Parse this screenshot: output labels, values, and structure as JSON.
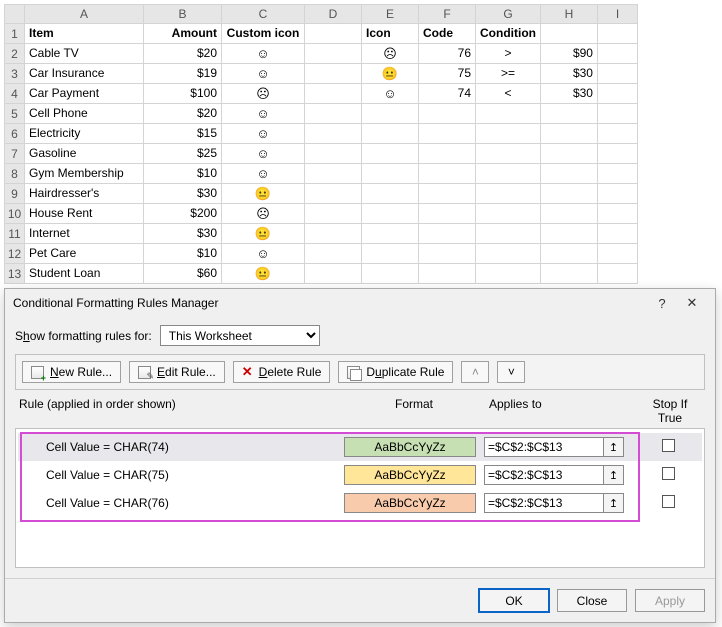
{
  "grid": {
    "columns": [
      "A",
      "B",
      "C",
      "D",
      "E",
      "F",
      "G",
      "H",
      "I"
    ],
    "headers": {
      "item": "Item",
      "amount": "Amount",
      "custom": "Custom icon",
      "icon": "Icon",
      "code": "Code",
      "condition": "Condition"
    },
    "rows": [
      {
        "n": 1
      },
      {
        "n": 2,
        "item": "Cable TV",
        "amount": "$20",
        "face": "☺",
        "faceCls": "bg-green",
        "icon": "☹",
        "code": "76",
        "cond": ">",
        "val": "$90"
      },
      {
        "n": 3,
        "item": "Car Insurance",
        "amount": "$19",
        "face": "☺",
        "faceCls": "bg-green",
        "icon": "😐",
        "code": "75",
        "cond": ">=",
        "val": "$30"
      },
      {
        "n": 4,
        "item": "Car Payment",
        "amount": "$100",
        "face": "☹",
        "faceCls": "bg-orange",
        "icon": "☺",
        "code": "74",
        "cond": "<",
        "val": "$30"
      },
      {
        "n": 5,
        "item": "Cell Phone",
        "amount": "$20",
        "face": "☺",
        "faceCls": "bg-green"
      },
      {
        "n": 6,
        "item": "Electricity",
        "amount": "$15",
        "face": "☺",
        "faceCls": "bg-green"
      },
      {
        "n": 7,
        "item": "Gasoline",
        "amount": "$25",
        "face": "☺",
        "faceCls": "bg-green"
      },
      {
        "n": 8,
        "item": "Gym Membership",
        "amount": "$10",
        "face": "☺",
        "faceCls": "bg-green"
      },
      {
        "n": 9,
        "item": "Hairdresser's",
        "amount": "$30",
        "face": "😐",
        "faceCls": "bg-yellow"
      },
      {
        "n": 10,
        "item": "House Rent",
        "amount": "$200",
        "face": "☹",
        "faceCls": "bg-orange"
      },
      {
        "n": 11,
        "item": "Internet",
        "amount": "$30",
        "face": "😐",
        "faceCls": "bg-yellow"
      },
      {
        "n": 12,
        "item": "Pet Care",
        "amount": "$10",
        "face": "☺",
        "faceCls": "bg-green"
      },
      {
        "n": 13,
        "item": "Student Loan",
        "amount": "$60",
        "face": "😐",
        "faceCls": "bg-yellow"
      }
    ]
  },
  "dialog": {
    "title": "Conditional Formatting Rules Manager",
    "help": "?",
    "close": "✕",
    "show_label_pre": "S",
    "show_label_u": "h",
    "show_label_post": "ow formatting rules for:",
    "show_value": "This Worksheet",
    "toolbar": {
      "new_u": "N",
      "new": "ew Rule...",
      "edit_u": "E",
      "edit": "dit Rule...",
      "delete_u": "D",
      "delete": "elete Rule",
      "dup": "D",
      "dup_u": "u",
      "dup_post": "plicate Rule"
    },
    "headers": {
      "rule": "Rule (applied in order shown)",
      "format": "Format",
      "applies": "Applies to",
      "stop": "Stop If True"
    },
    "rules": [
      {
        "rule": "Cell Value = CHAR(74)",
        "fmt": "AaBbCcYyZz",
        "fmtCls": "bg-green",
        "applies": "=$C$2:$C$13"
      },
      {
        "rule": "Cell Value = CHAR(75)",
        "fmt": "AaBbCcYyZz",
        "fmtCls": "bg-yellow",
        "applies": "=$C$2:$C$13"
      },
      {
        "rule": "Cell Value = CHAR(76)",
        "fmt": "AaBbCcYyZz",
        "fmtCls": "bg-orange",
        "applies": "=$C$2:$C$13"
      }
    ],
    "buttons": {
      "ok": "OK",
      "close": "Close",
      "apply": "Apply"
    }
  }
}
